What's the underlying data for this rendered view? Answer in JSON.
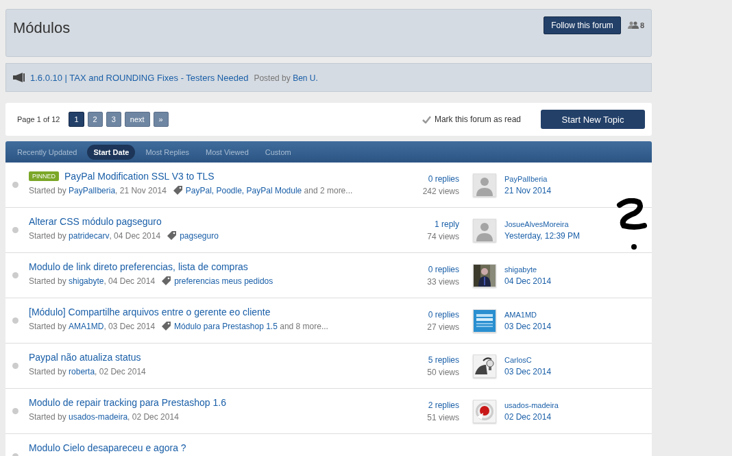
{
  "forum": {
    "title": "Módulos",
    "follow_button": "Follow this forum",
    "followers": "8"
  },
  "announcement": {
    "title": "1.6.0.10 | TAX and ROUNDING Fixes - Testers Needed",
    "posted_by": "Posted by",
    "author": "Ben U."
  },
  "pagination": {
    "label": "Page 1 of 12",
    "pages": [
      {
        "label": "1",
        "selected": true
      },
      {
        "label": "2",
        "selected": false
      },
      {
        "label": "3",
        "selected": false
      }
    ],
    "next": "next",
    "last": "»"
  },
  "mark_read": "Mark this forum as read",
  "start_button": "Start New Topic",
  "sort_tabs": [
    {
      "label": "Recently Updated",
      "selected": false
    },
    {
      "label": "Start Date",
      "selected": true
    },
    {
      "label": "Most Replies",
      "selected": false
    },
    {
      "label": "Most Viewed",
      "selected": false
    },
    {
      "label": "Custom",
      "selected": false
    }
  ],
  "topics": [
    {
      "badge": "PINNED",
      "title": "PayPal Modification SSL V3 to TLS",
      "started_label": "Started by",
      "author": "PayPalIberia",
      "date": ", 21 Nov 2014",
      "tags": "PayPal, Poodle, PayPal Module",
      "more": "and 2 more...",
      "replies": "0 replies",
      "views": "242 views",
      "avatar": {
        "kind": "silhouette"
      },
      "last_poster": "PayPalIberia",
      "last_date": "21 Nov 2014"
    },
    {
      "title": "Alterar CSS módulo pagseguro",
      "started_label": "Started by",
      "author": "patridecarv",
      "date": ", 04 Dec 2014",
      "tags": "pagseguro",
      "replies": "1 reply",
      "views": "74 views",
      "avatar": {
        "kind": "silhouette"
      },
      "last_poster": "JosueAlvesMoreira",
      "last_date": "Yesterday, 12:39 PM"
    },
    {
      "title": "Modulo de link direto preferencias, lista de compras",
      "started_label": "Started by",
      "author": "shigabyte",
      "date": ", 04 Dec 2014",
      "tags": "preferencias meus pedidos",
      "replies": "0 replies",
      "views": "33 views",
      "last_poster": "shigabyte",
      "last_date": "04 Dec 2014"
    },
    {
      "title": "[Módulo] Compartilhe arquivos entre o gerente eo cliente",
      "started_label": "Started by",
      "author": "AMA1MD",
      "date": ", 03 Dec 2014",
      "tags": "Módulo para Prestashop 1.5",
      "more": "and 8 more...",
      "replies": "0 replies",
      "views": "27 views",
      "last_poster": "AMA1MD",
      "last_date": "03 Dec 2014"
    },
    {
      "title": "Paypal não atualiza status",
      "started_label": "Started by",
      "author": "roberta",
      "date": ", 02 Dec 2014",
      "replies": "5 replies",
      "views": "50 views",
      "last_poster": "CarlosC",
      "last_date": "03 Dec 2014"
    },
    {
      "title": "Modulo de repair tracking para Prestashop 1.6",
      "started_label": "Started by",
      "author": "usados-madeira",
      "date": ", 02 Dec 2014",
      "replies": "2 replies",
      "views": "51 views",
      "last_poster": "usados-madeira",
      "last_date": "02 Dec 2014"
    },
    {
      "title": "Modulo Cielo desapareceu e agora ?"
    }
  ]
}
